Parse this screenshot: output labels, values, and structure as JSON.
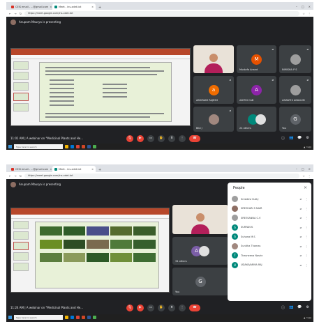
{
  "screens": [
    {
      "tabs": [
        {
          "label": "CEIS email - ...@gmail.com",
          "active": false
        },
        {
          "label": "Meet - ins-xdet-txt",
          "active": true
        }
      ],
      "address": "https://meet.google.com/ins-xdet-txt",
      "presenting": "Anupam Maurya is presenting",
      "time": "11:01 AM",
      "meeting_title": "A webinar on \"Medicinal Plants and He...",
      "tiles": [
        {
          "name": "Mustafa Anand",
          "initial": "M",
          "color": "#e65100"
        },
        {
          "name": "NIMISHA P S",
          "initial": "",
          "color": "#9e9e9e"
        },
        {
          "name": "ABHIRAMI RAJESH",
          "initial": "a",
          "color": "#ef6c00"
        },
        {
          "name": "ADITHI CAB",
          "initial": "A",
          "color": "#8e24aa"
        },
        {
          "name": "ASWATHI ANILKUM",
          "initial": "",
          "color": "#9e9e9e"
        },
        {
          "name": "Bibi J",
          "initial": "",
          "color": "#a1887f"
        },
        {
          "name": "24 others",
          "initial": "",
          "color": "#00897b"
        },
        {
          "name": "You",
          "initial": "G",
          "color": "#5f6368"
        }
      ],
      "taskbar_search": "Type here to search"
    },
    {
      "tabs": [
        {
          "label": "CEIS email - ...@gmail.com",
          "active": false
        },
        {
          "label": "Meet - ins-xdet-txt",
          "active": true
        }
      ],
      "address": "https://meet.google.com/ins-xdet-txt",
      "presenting": "Anupam Maurya is presenting",
      "time": "11:24 AM",
      "meeting_title": "A webinar on \"Medicinal Plants and He...",
      "tiles": [
        {
          "name": "34 others",
          "initial": "A",
          "color": "#7b5ea7"
        },
        {
          "name": "You",
          "initial": "G",
          "color": "#5f6368"
        }
      ],
      "people_panel": {
        "title": "People",
        "list": [
          {
            "name": "Sreedevi Kutty",
            "initial": "",
            "color": "#9e9e9e"
          },
          {
            "name": "SREEHARI S NAIR",
            "initial": "",
            "color": "#8d6e63"
          },
          {
            "name": "SREESANNA C.V",
            "initial": "",
            "color": "#9e9e9e"
          },
          {
            "name": "SURYAN K",
            "initial": "S",
            "color": "#00897b"
          },
          {
            "name": "Suhana M.S",
            "initial": "S",
            "color": "#00897b"
          },
          {
            "name": "Sunitha Thomas",
            "initial": "",
            "color": "#a1887f"
          },
          {
            "name": "Thasneena Nasrin",
            "initial": "T",
            "color": "#00897b"
          },
          {
            "name": "UDAYAVARMA RAJ",
            "initial": "U",
            "color": "#00897b"
          }
        ]
      },
      "taskbar_search": "Type here to search"
    }
  ]
}
